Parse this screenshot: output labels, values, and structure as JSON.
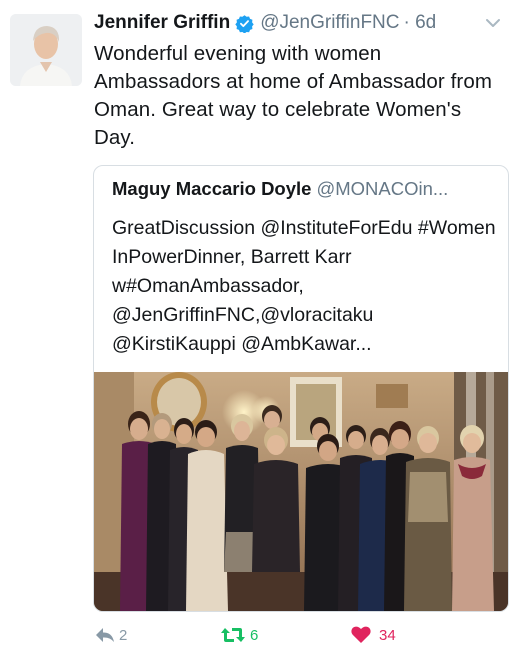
{
  "tweet": {
    "author_name": "Jennifer Griffin",
    "author_handle": "@JenGriffinFNC",
    "time": "· 6d",
    "text": "Wonderful evening with women Ambassadors at home of Ambassador from Oman. Great way to celebrate Women's Day."
  },
  "quoted_tweet": {
    "author_name": "Maguy Maccario Doyle",
    "author_handle": "@MONACOin...",
    "text": "GreatDiscussion @InstituteForEdu #Women InPowerDinner, Barrett Karr w#OmanAmbassador, @JenGriffinFNC,@vloracitaku @KirstiKauppi @AmbKawar..."
  },
  "actions": {
    "reply_count": "2",
    "retweet_count": "6",
    "like_count": "34"
  },
  "colors": {
    "verified": "#1da1f2",
    "retweet_active": "#17bf63",
    "like_active": "#e0245e",
    "muted": "#8899a6"
  },
  "icons": [
    "verified-badge-icon",
    "chevron-down-icon",
    "reply-icon",
    "retweet-icon",
    "heart-icon"
  ]
}
